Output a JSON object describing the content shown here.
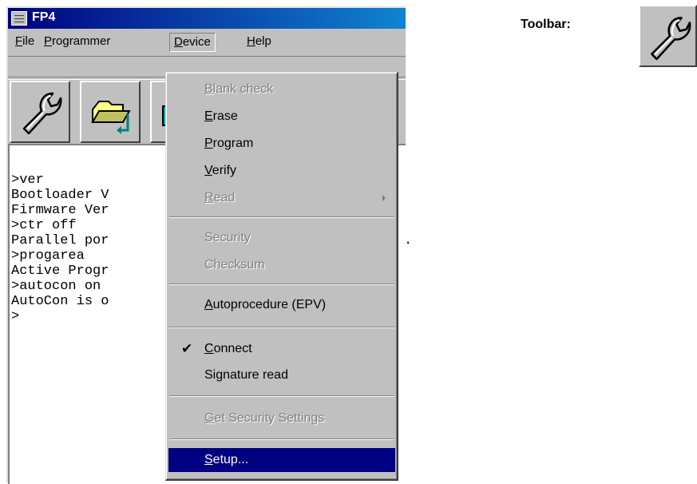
{
  "window": {
    "title": "FP4",
    "menubar": [
      "File",
      "Programmer",
      "Device",
      "Help"
    ]
  },
  "toolbar": {
    "buttons": [
      {
        "icon": "wrench-icon"
      },
      {
        "icon": "open-folder-icon"
      },
      {
        "icon": "upload-icon"
      }
    ]
  },
  "console": {
    "lines": [
      ">ver",
      "Bootloader V",
      "Firmware Ver",
      ">ctr off",
      "Parallel por",
      ">progarea",
      "Active Progr",
      ">autocon on",
      "AutoCon is o",
      ">"
    ],
    "trailing_dot": "."
  },
  "device_menu": {
    "blank_check": "Blank check",
    "erase": "Erase",
    "program": "Program",
    "verify": "Verify",
    "read": "Read",
    "security": "Security",
    "checksum": "Checksum",
    "autoprocedure": "Autoprocedure (EPV)",
    "connect": "Connect",
    "connect_check": "✔",
    "signature_read": "Signature read",
    "get_security_settings": "Get Security Settings",
    "setup": "Setup..."
  },
  "note": {
    "label": "Toolbar:",
    "icon": "wrench-icon"
  },
  "colors": {
    "title_bar": "#000080",
    "face": "#c0c0c0",
    "highlight": "#000080",
    "disabled_text": "#808080"
  }
}
